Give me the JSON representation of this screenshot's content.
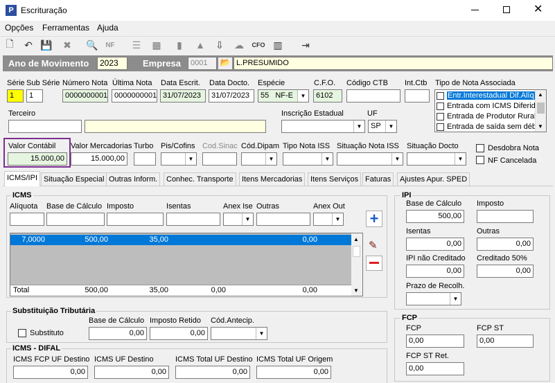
{
  "window": {
    "title": "Escrituração",
    "app_icon": "P"
  },
  "menu": [
    "Opções",
    "Ferramentas",
    "Ajuda"
  ],
  "header": {
    "ano_label": "Ano de Movimento",
    "ano_value": "2023",
    "empresa_label": "Empresa",
    "empresa_code": "0001",
    "empresa_name": "L.PRESUMIDO"
  },
  "labels": {
    "serie": "Série",
    "sub_serie": "Sub Série",
    "numero_nota": "Número Nota",
    "ultima_nota": "Última Nota",
    "data_escrit": "Data Escrit.",
    "data_docto": "Data Docto.",
    "especie": "Espécie",
    "cfo": "C.F.O.",
    "codigo_ctb": "Código CTB",
    "int_ctb": "Int.Ctb",
    "tipo_nota_assoc": "Tipo de Nota Associada",
    "terceiro": "Terceiro",
    "inscricao": "Inscrição Estadual",
    "uf": "UF",
    "valor_contabil": "Valor Contábil",
    "valor_mercadorias": "Valor Mercadorias",
    "turbo": "Turbo",
    "pis_cofins": "Pis/Cofins",
    "cod_sinac": "Cod.Sinac",
    "cod_dipam": "Cód.Dipam",
    "tipo_nota_iss": "Tipo Nota ISS",
    "situacao_nota_iss": "Situação Nota ISS",
    "situacao_docto": "Situação Docto",
    "desdobra_nota": "Desdobra Nota",
    "nf_cancelada": "NF Cancelada"
  },
  "values": {
    "serie": "1",
    "sub_serie": "1",
    "numero_nota": "0000000001",
    "ultima_nota": "0000000001",
    "data_escrit": "31/07/2023",
    "data_docto": "31/07/2023",
    "especie_code": "55",
    "especie": "NF-E",
    "cfo": "6102",
    "uf": "SP",
    "valor_contabil": "15.000,00",
    "valor_mercadorias": "15.000,00"
  },
  "tipo_nota_list": [
    "Entr.Interestadual Dif.Alíq",
    "Entrada com ICMS Diferido",
    "Entrada de Produtor Rural",
    "Entrada de saída sem débi"
  ],
  "tabs": [
    "ICMS/IPI",
    "Situação Especial",
    "Outras Inform.",
    "Conhec. Transporte",
    "Itens Mercadorias",
    "Itens Serviços",
    "Faturas",
    "Ajustes Apur. SPED"
  ],
  "icms": {
    "title": "ICMS",
    "aliquota": "Alíquota",
    "base_calculo": "Base de Cálculo",
    "imposto": "Imposto",
    "isentas": "Isentas",
    "anex_ise": "Anex Ise",
    "outras": "Outras",
    "anex_out": "Anex Out",
    "row": {
      "aliquota": "7,0000",
      "base": "500,00",
      "imposto": "35,00",
      "outras": "0,00"
    },
    "total_label": "Total",
    "total": {
      "base": "500,00",
      "imposto": "35,00",
      "isentas": "0,00",
      "outras": "0,00"
    }
  },
  "st": {
    "title": "Substituição Tributária",
    "substituto": "Substituto",
    "base_label": "Base de Cálculo",
    "base": "0,00",
    "retido_label": "Imposto Retido",
    "retido": "0,00",
    "antecip_label": "Cód.Antecip."
  },
  "difal": {
    "title": "ICMS - DIFAL",
    "fcp_label": "ICMS FCP UF Destino",
    "fcp": "0,00",
    "uf_dest_label": "ICMS UF Destino",
    "uf_dest": "0,00",
    "total_dest_label": "ICMS Total UF Destino",
    "total_dest": "0,00",
    "total_orig_label": "ICMS Total UF Origem",
    "total_orig": "0,00"
  },
  "ipi": {
    "title": "IPI",
    "base_label": "Base de Cálculo",
    "base": "500,00",
    "imposto_label": "Imposto",
    "isentas_label": "Isentas",
    "isentas": "0,00",
    "outras_label": "Outras",
    "outras": "0,00",
    "nao_cred_label": "IPI não Creditado",
    "nao_cred": "0,00",
    "cred50_label": "Creditado 50%",
    "cred50": "0,00",
    "prazo_label": "Prazo de Recolh."
  },
  "fcp": {
    "title": "FCP",
    "fcp_label": "FCP",
    "fcp": "0,00",
    "fcp_st_label": "FCP ST",
    "fcp_st": "0,00",
    "fcp_st_ret_label": "FCP ST Ret.",
    "fcp_st_ret": "0,00"
  },
  "colors": {
    "highlight_box": "#7b2d8e",
    "row_selected": "#0078d7",
    "header_bar": "#8c8c8c"
  }
}
